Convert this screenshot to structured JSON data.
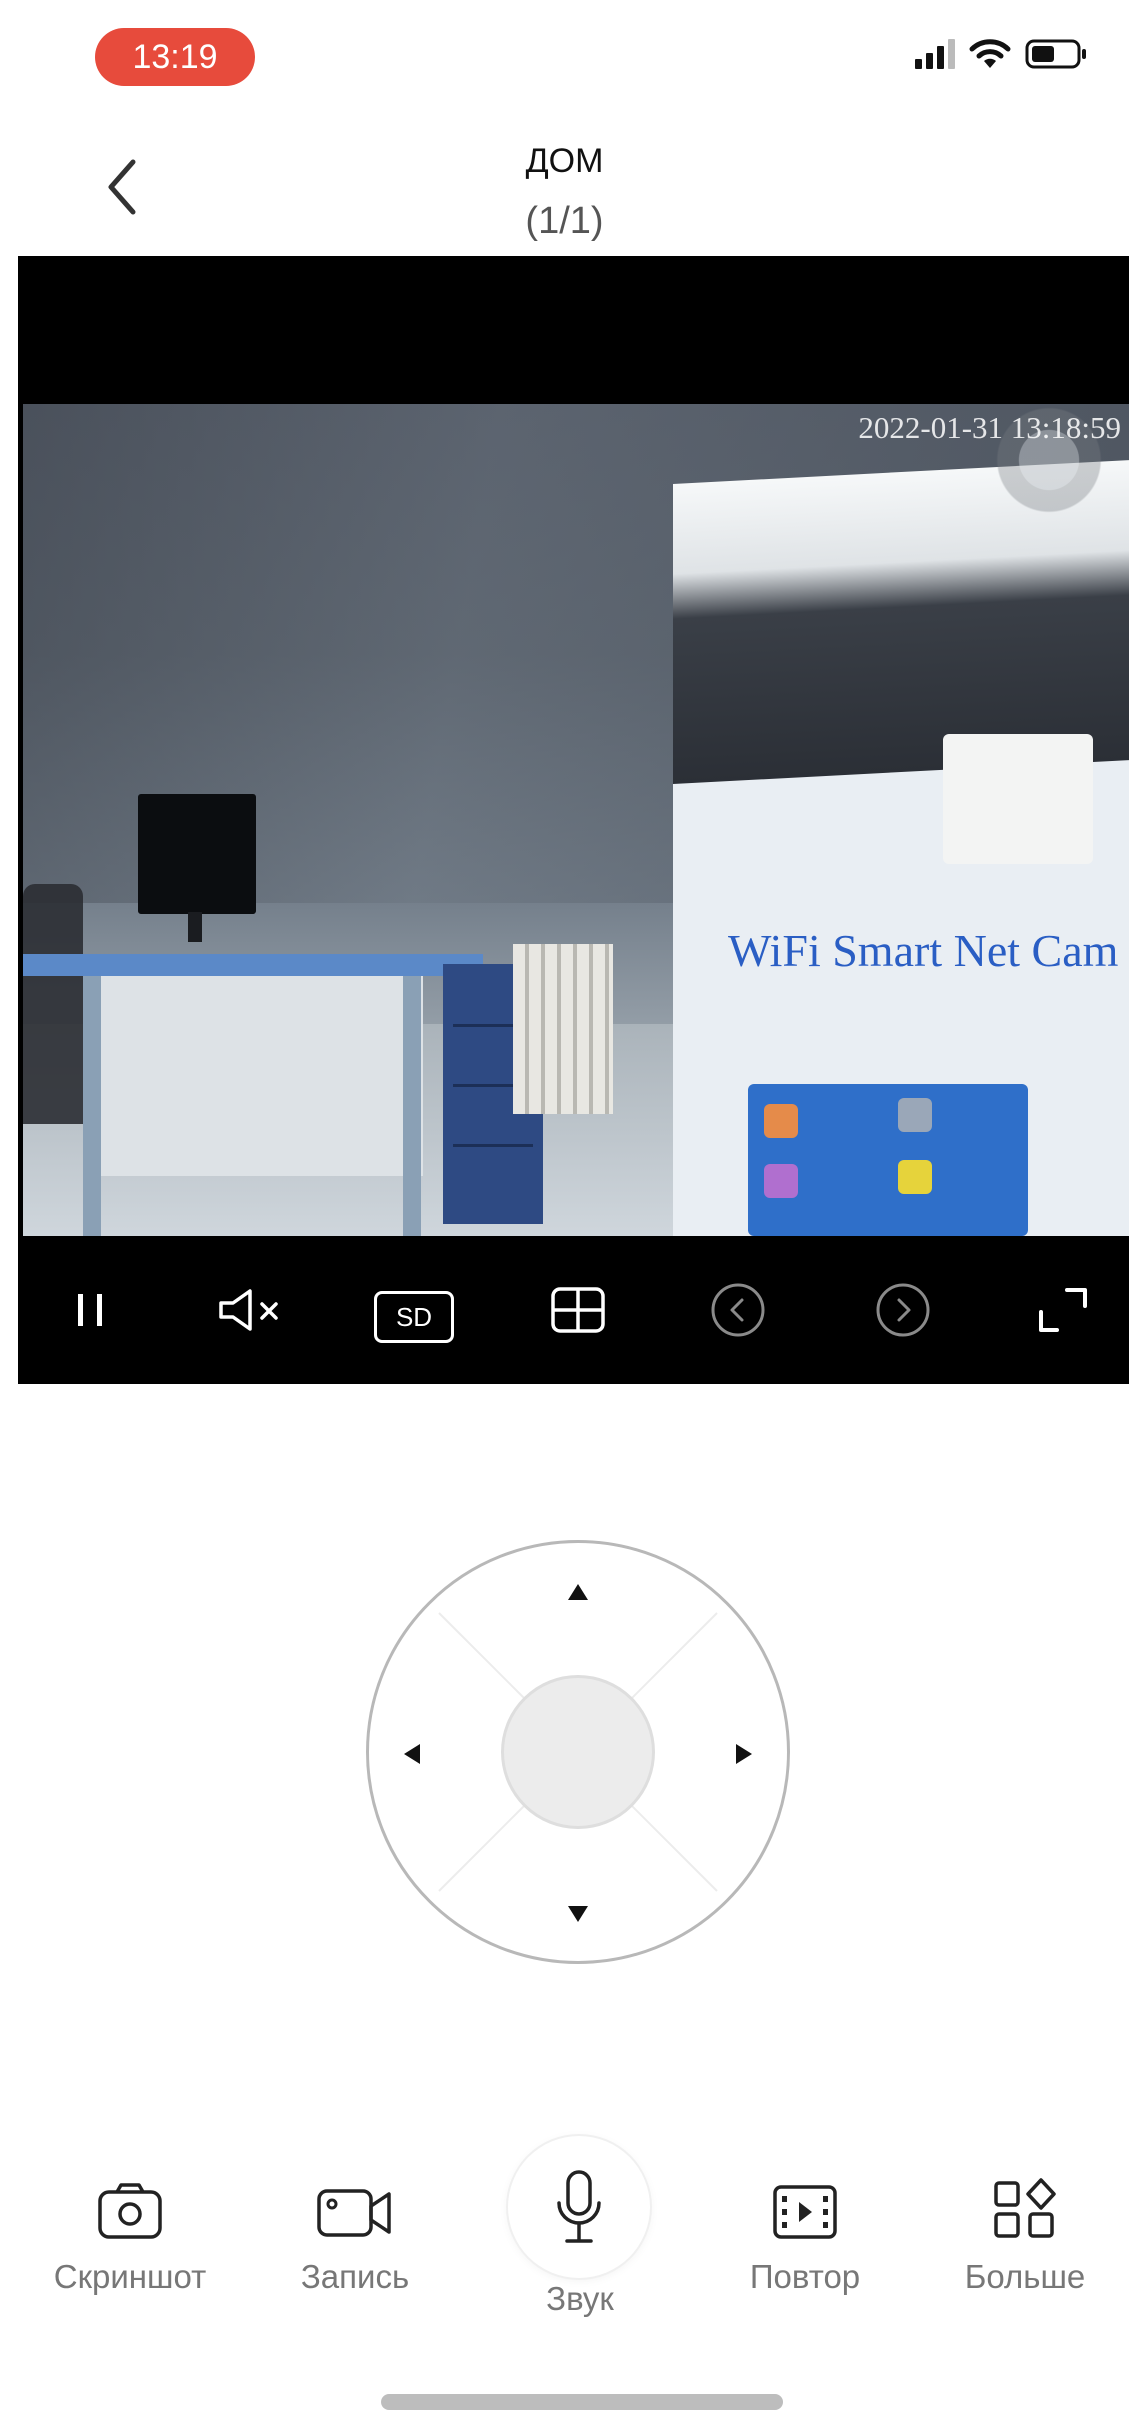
{
  "status_bar": {
    "time": "13:19",
    "time_pill_color": "#e74b3c",
    "icons": [
      "signal-icon",
      "wifi-icon",
      "battery-icon"
    ]
  },
  "header": {
    "back_icon": "chevron-left-icon",
    "title": "ДОМ",
    "subtitle": "(1/1)"
  },
  "video": {
    "timestamp": "2022-01-31  13:18:59",
    "scene_text": "WiFi Smart Net Cam",
    "controls": {
      "pause_icon": "pause-icon",
      "mute_icon": "speaker-muted-icon",
      "quality_label": "SD",
      "grid_icon": "grid-icon",
      "prev_icon": "chevron-left-circle-icon",
      "next_icon": "chevron-right-circle-icon",
      "fullscreen_icon": "fullscreen-icon"
    }
  },
  "ptz": {
    "up_icon": "arrow-up-icon",
    "down_icon": "arrow-down-icon",
    "left_icon": "arrow-left-icon",
    "right_icon": "arrow-right-icon"
  },
  "toolbar": {
    "screenshot_label": "Скриншот",
    "record_label": "Запись",
    "sound_label": "Звук",
    "playback_label": "Повтор",
    "more_label": "Больше"
  },
  "colors": {
    "accent_red": "#e74b3c",
    "label_gray": "#777777"
  }
}
